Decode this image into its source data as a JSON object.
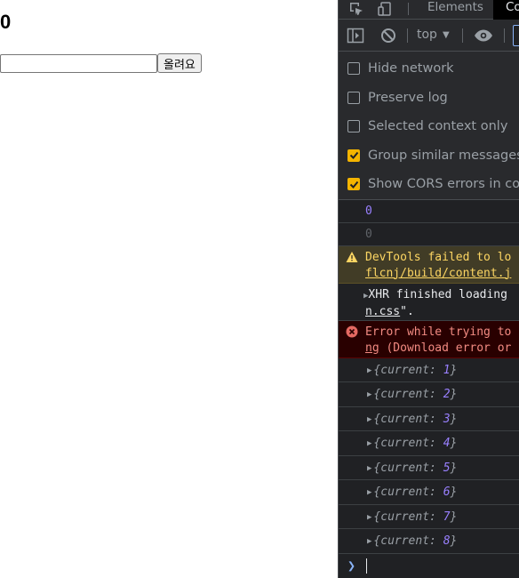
{
  "page": {
    "counter": "0",
    "input_value": "",
    "submit_label": "올려요"
  },
  "devtools": {
    "tabs": [
      {
        "label": "Elements",
        "active": false
      },
      {
        "label": "Co",
        "active": true
      }
    ],
    "toolbar": {
      "context": "top"
    },
    "settings": [
      {
        "label": "Hide network",
        "checked": false
      },
      {
        "label": "Preserve log",
        "checked": false
      },
      {
        "label": "Selected context only",
        "checked": false
      },
      {
        "label": "Group similar messages in",
        "checked": true
      },
      {
        "label": "Show CORS errors in cons",
        "checked": true
      }
    ],
    "console": {
      "log1": "0",
      "log2": "0",
      "warning": {
        "line1": "DevTools failed to lo",
        "link": "flcnj/build/content.j"
      },
      "info": {
        "line1": "XHR finished loading",
        "link": "n.css",
        "tail": "\"."
      },
      "error": {
        "line1": "Error while trying to",
        "link": "ng",
        "tail": " (Download error or"
      },
      "objects": [
        {
          "key": "current",
          "value": "1"
        },
        {
          "key": "current",
          "value": "2"
        },
        {
          "key": "current",
          "value": "3"
        },
        {
          "key": "current",
          "value": "4"
        },
        {
          "key": "current",
          "value": "5"
        },
        {
          "key": "current",
          "value": "6"
        },
        {
          "key": "current",
          "value": "7"
        },
        {
          "key": "current",
          "value": "8"
        }
      ]
    },
    "colors": {
      "background": "#202124",
      "number": "#9980ff",
      "warning_bg": "#413c26",
      "error_bg": "#290000",
      "checkbox_on": "#f4b400"
    }
  }
}
